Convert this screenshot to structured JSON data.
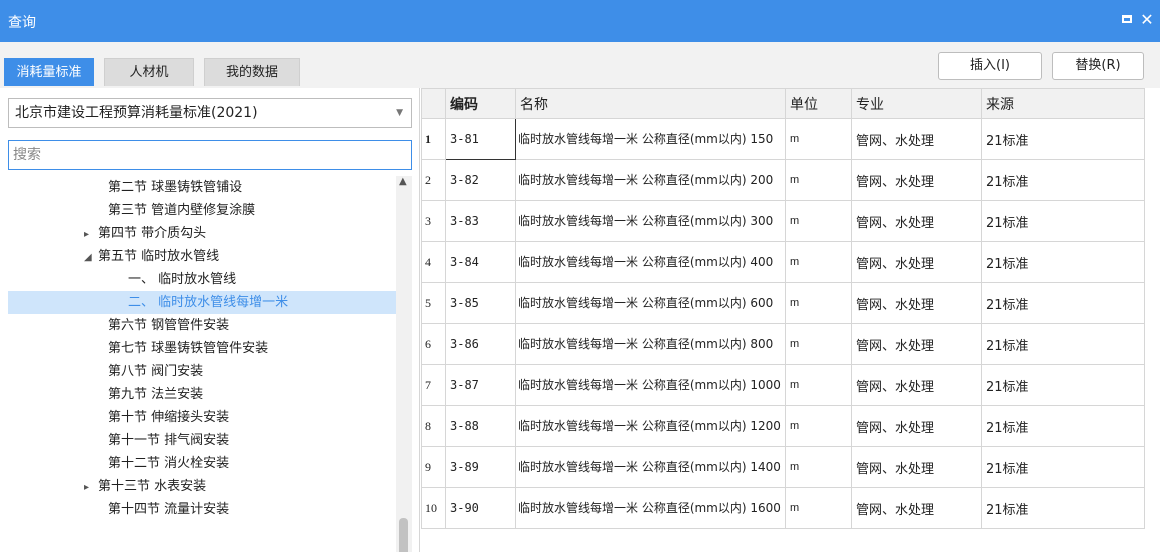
{
  "window": {
    "title": "查询"
  },
  "tabs": [
    "消耗量标准",
    "人材机",
    "我的数据"
  ],
  "buttons": {
    "insert": "插入(I)",
    "replace": "替换(R)"
  },
  "standard_select": "北京市建设工程预算消耗量标准(2021)",
  "search": {
    "placeholder": "搜索",
    "value": ""
  },
  "tree": [
    {
      "label": "第二节 球墨铸铁管铺设",
      "exp": ""
    },
    {
      "label": "第三节 管道内壁修复涂膜",
      "exp": ""
    },
    {
      "label": "第四节 带介质勾头",
      "exp": "▸"
    },
    {
      "label": "第五节 临时放水管线",
      "exp": "◢"
    },
    {
      "label": "一、 临时放水管线",
      "exp": ""
    },
    {
      "label": "二、 临时放水管线每增一米",
      "exp": ""
    },
    {
      "label": "第六节 钢管管件安装",
      "exp": ""
    },
    {
      "label": "第七节 球墨铸铁管管件安装",
      "exp": ""
    },
    {
      "label": "第八节 阀门安装",
      "exp": ""
    },
    {
      "label": "第九节 法兰安装",
      "exp": ""
    },
    {
      "label": "第十节 伸缩接头安装",
      "exp": ""
    },
    {
      "label": "第十一节 排气阀安装",
      "exp": ""
    },
    {
      "label": "第十二节 消火栓安装",
      "exp": ""
    },
    {
      "label": "第十三节 水表安装",
      "exp": "▸"
    },
    {
      "label": "第十四节 流量计安装",
      "exp": ""
    }
  ],
  "table": {
    "headers": [
      "",
      "编码",
      "名称",
      "单位",
      "专业",
      "来源"
    ],
    "rows": [
      {
        "no": "1",
        "code": "3-81",
        "name": "临时放水管线每增一米 公称直径(mm以内) 150",
        "unit": "m",
        "major": "管网、水处理",
        "source": "21标准"
      },
      {
        "no": "2",
        "code": "3-82",
        "name": "临时放水管线每增一米 公称直径(mm以内) 200",
        "unit": "m",
        "major": "管网、水处理",
        "source": "21标准"
      },
      {
        "no": "3",
        "code": "3-83",
        "name": "临时放水管线每增一米 公称直径(mm以内) 300",
        "unit": "m",
        "major": "管网、水处理",
        "source": "21标准"
      },
      {
        "no": "4",
        "code": "3-84",
        "name": "临时放水管线每增一米 公称直径(mm以内) 400",
        "unit": "m",
        "major": "管网、水处理",
        "source": "21标准"
      },
      {
        "no": "5",
        "code": "3-85",
        "name": "临时放水管线每增一米 公称直径(mm以内) 600",
        "unit": "m",
        "major": "管网、水处理",
        "source": "21标准"
      },
      {
        "no": "6",
        "code": "3-86",
        "name": "临时放水管线每增一米 公称直径(mm以内) 800",
        "unit": "m",
        "major": "管网、水处理",
        "source": "21标准"
      },
      {
        "no": "7",
        "code": "3-87",
        "name": "临时放水管线每增一米 公称直径(mm以内) 1000",
        "unit": "m",
        "major": "管网、水处理",
        "source": "21标准"
      },
      {
        "no": "8",
        "code": "3-88",
        "name": "临时放水管线每增一米 公称直径(mm以内) 1200",
        "unit": "m",
        "major": "管网、水处理",
        "source": "21标准"
      },
      {
        "no": "9",
        "code": "3-89",
        "name": "临时放水管线每增一米 公称直径(mm以内) 1400",
        "unit": "m",
        "major": "管网、水处理",
        "source": "21标准"
      },
      {
        "no": "10",
        "code": "3-90",
        "name": "临时放水管线每增一米 公称直径(mm以内) 1600",
        "unit": "m",
        "major": "管网、水处理",
        "source": "21标准"
      }
    ]
  },
  "colors": {
    "accent": "#3e8ee8",
    "selected_bg": "#cfe5fb"
  }
}
